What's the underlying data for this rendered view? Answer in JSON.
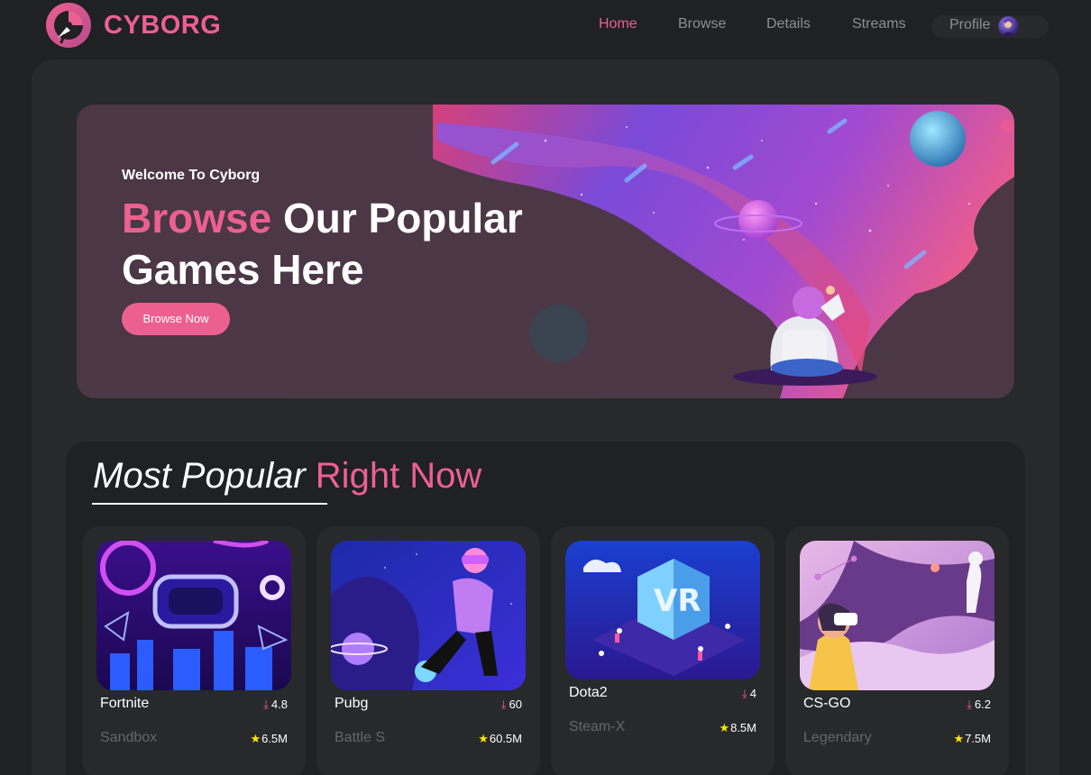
{
  "header": {
    "brand": "CYBORG",
    "nav": [
      {
        "label": "Home",
        "active": true
      },
      {
        "label": "Browse",
        "active": false
      },
      {
        "label": "Details",
        "active": false
      },
      {
        "label": "Streams",
        "active": false
      },
      {
        "label": "Profile",
        "active": false
      }
    ]
  },
  "banner": {
    "welcome": "Welcome To Cyborg",
    "headline_accent": "Browse",
    "headline_rest": "Our Popular Games Here",
    "button_label": "Browse Now"
  },
  "popular": {
    "title_white": "Most Popular",
    "title_pink": "Right Now",
    "cards": [
      {
        "name": "Fortnite",
        "downloads": "4.8",
        "category": "Sandbox",
        "rating": "6.5M"
      },
      {
        "name": "Pubg",
        "downloads": "60",
        "category": "Battle S",
        "rating": "60.5M"
      },
      {
        "name": "Dota2",
        "downloads": "4",
        "category": "Steam-X",
        "rating": "8.5M"
      },
      {
        "name": "CS-GO",
        "downloads": "6.2",
        "category": "Legendary",
        "rating": "7.5M"
      }
    ]
  },
  "icons": {
    "download": "download-icon",
    "star": "star-icon"
  },
  "colors": {
    "accent": "#ec6090",
    "background": "#1f2122",
    "panel": "#27292a",
    "muted": "#666666",
    "star": "#ffe600"
  }
}
